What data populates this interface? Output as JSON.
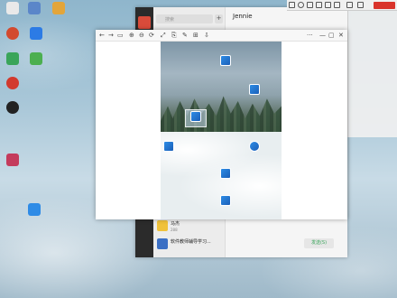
{
  "desktop": {
    "icons": [
      {
        "label": "",
        "color": "#e9e9e9"
      },
      {
        "label": "",
        "color": "#5b86c9"
      },
      {
        "label": "",
        "color": "#e3a53a"
      },
      {
        "label": "",
        "color": "#d34a2f"
      },
      {
        "label": "",
        "color": "#2c7be5"
      },
      {
        "label": "",
        "color": "#3aa55a"
      },
      {
        "label": "",
        "color": "#4caf50"
      },
      {
        "label": "",
        "color": "#d23a2e"
      },
      {
        "label": "",
        "color": "#222222"
      },
      {
        "label": "",
        "color": "#c43b5c"
      },
      {
        "label": "",
        "color": "#2e8be6"
      }
    ]
  },
  "chat": {
    "search_placeholder": "搜索",
    "plus_label": "+",
    "contact_title": "Jennie",
    "rows": [
      {
        "name": "马杰",
        "sub": "288"
      },
      {
        "name": "软件教师辅导学习...",
        "sub": ""
      }
    ],
    "send_label": "发送(S)"
  },
  "viewer": {
    "toolbar": [
      "←",
      "→",
      "▭",
      "⊕",
      "⊖",
      "⟳",
      "⤢",
      "⎘",
      "✎",
      "⊞",
      "⇩"
    ],
    "window_controls": [
      "···",
      "—",
      "▢",
      "✕"
    ],
    "photo_icons": [
      {
        "label": ""
      },
      {
        "label": ""
      },
      {
        "label": ""
      },
      {
        "label": ""
      },
      {
        "label": ""
      },
      {
        "label": ""
      },
      {
        "label": ""
      }
    ]
  },
  "colors": {
    "accent_red": "#d9342b",
    "send_green": "#3aa55a"
  }
}
